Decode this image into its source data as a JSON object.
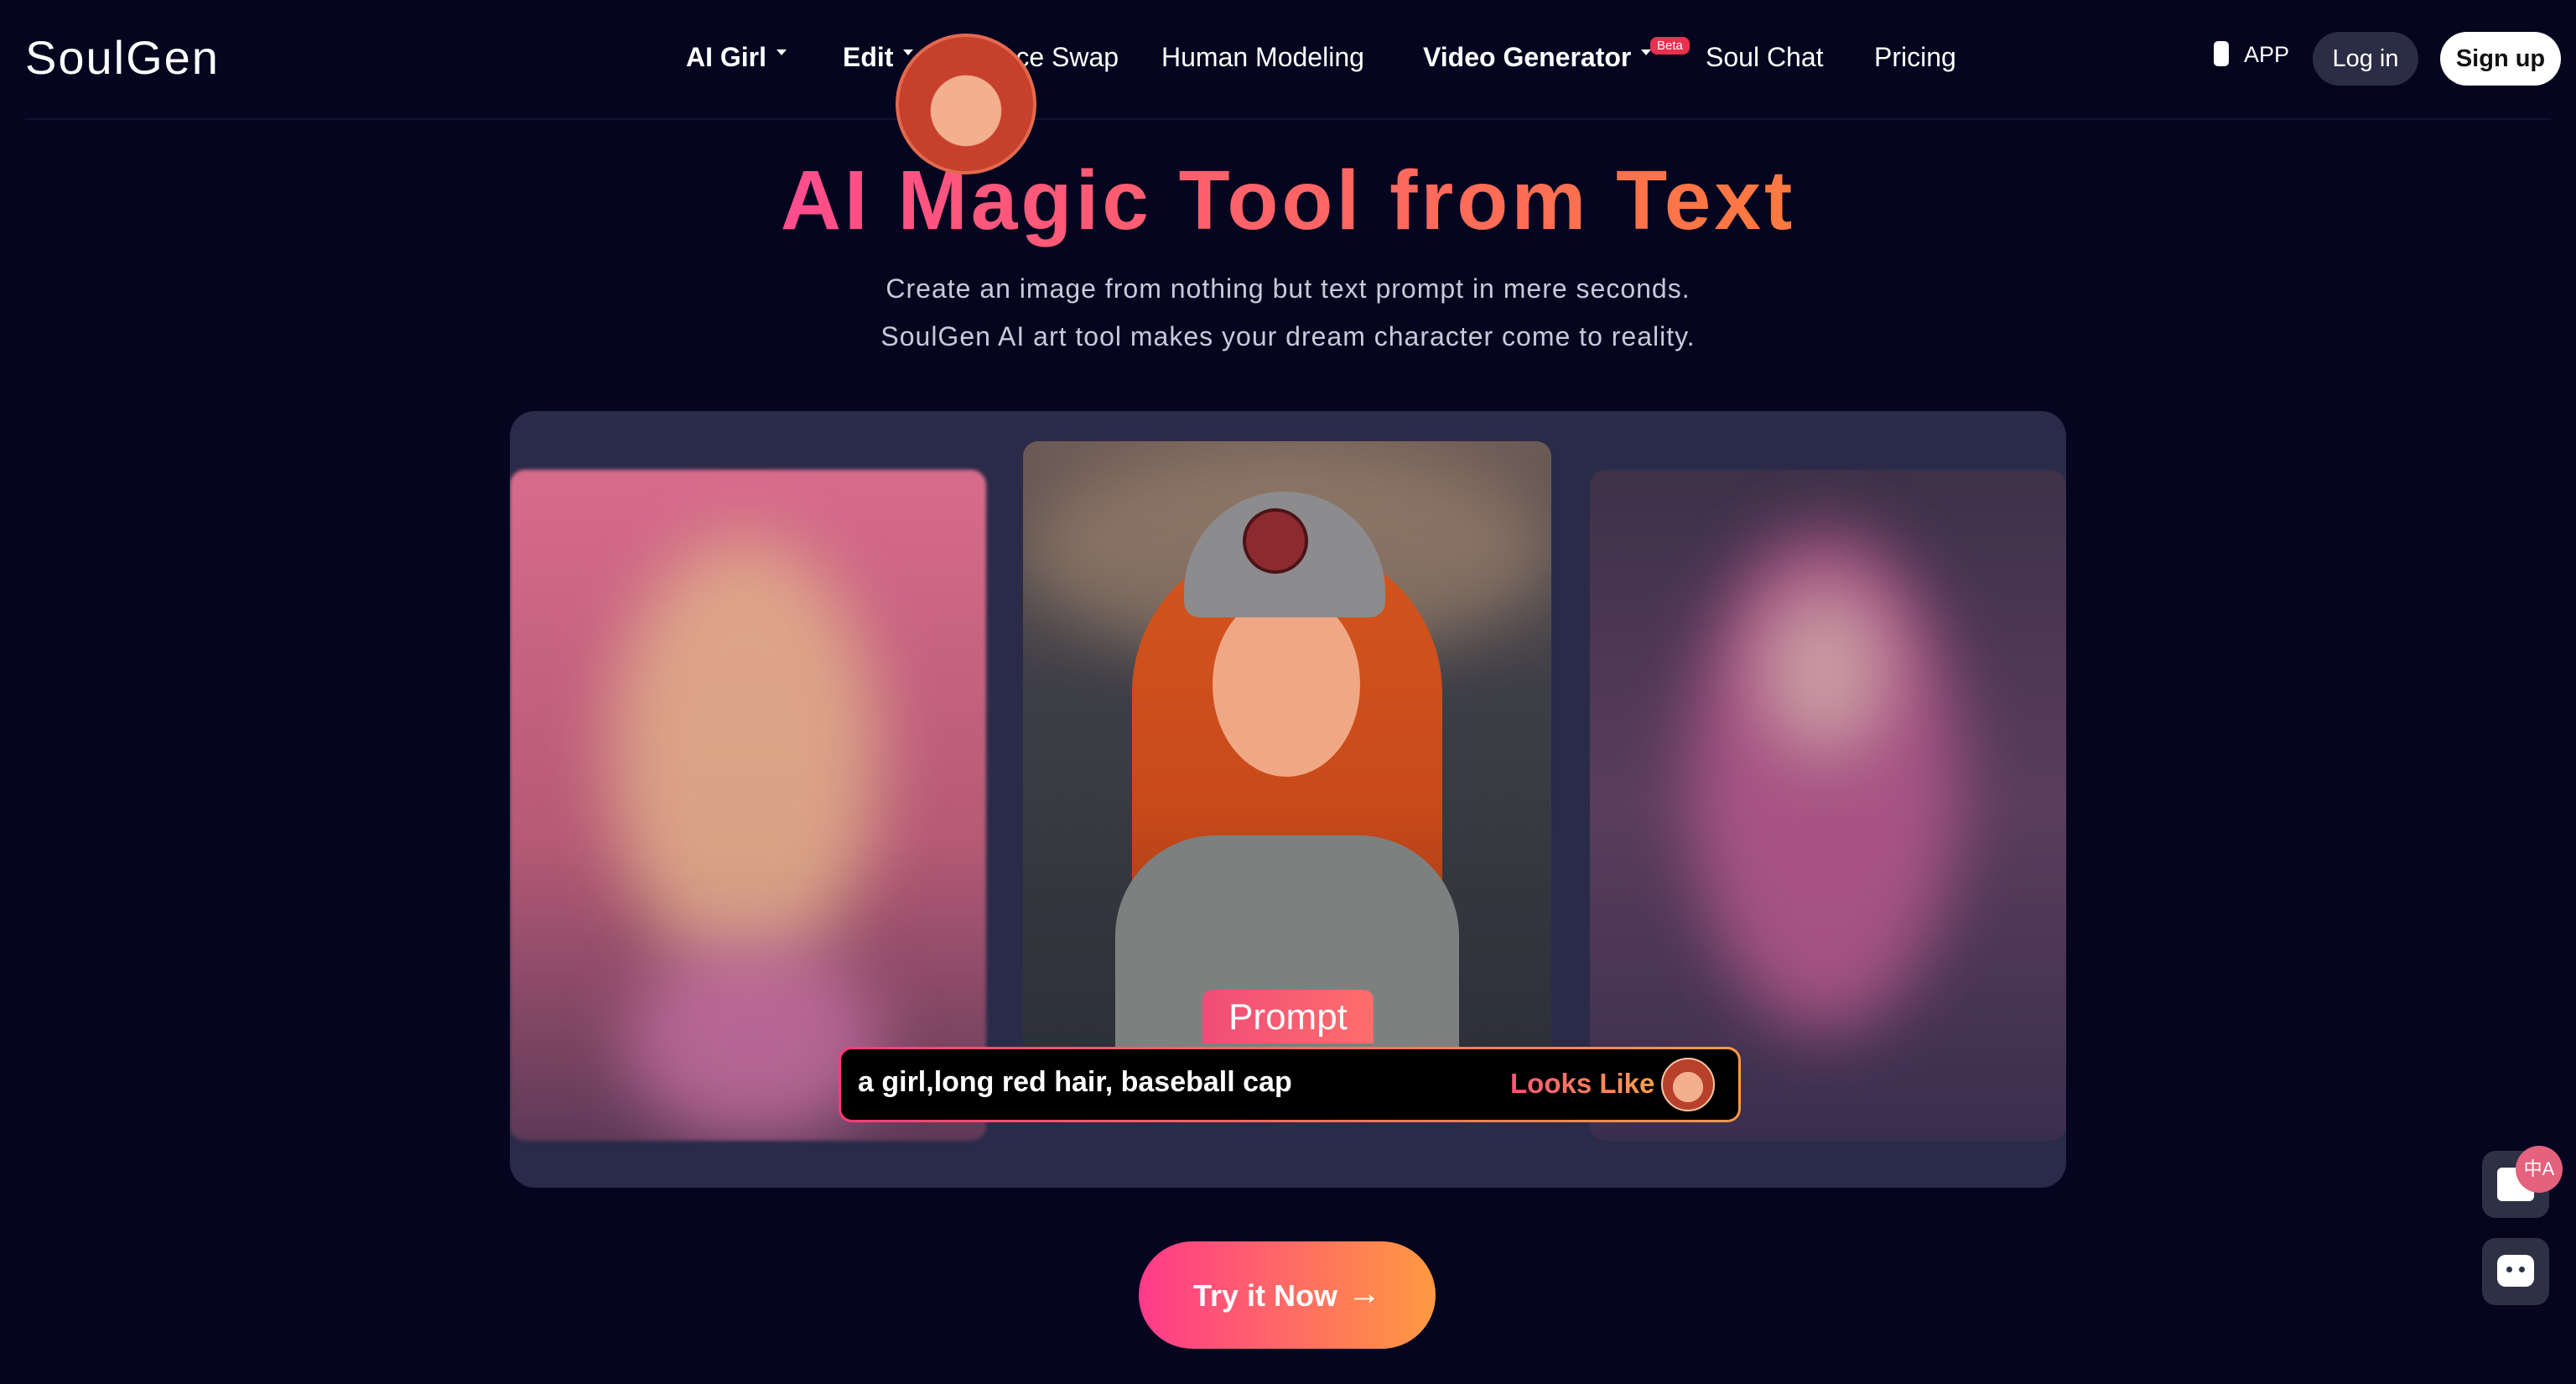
{
  "brand": {
    "logo_text": "SoulGen"
  },
  "nav": {
    "items": [
      {
        "label": "AI Girl",
        "has_caret": true
      },
      {
        "label": "Edit",
        "has_caret": true
      },
      {
        "label": "Face Swap",
        "has_caret": false
      },
      {
        "label": "Human Modeling",
        "has_caret": false
      },
      {
        "label": "Video Generator",
        "has_caret": true,
        "badge": "Beta"
      },
      {
        "label": "Soul Chat",
        "has_caret": false
      },
      {
        "label": "Pricing",
        "has_caret": false
      }
    ],
    "app_label": "APP",
    "login_label": "Log in",
    "signup_label": "Sign up"
  },
  "hero": {
    "title": "AI Magic Tool from Text",
    "subtitle_line1": "Create an image from nothing but text prompt in mere seconds.",
    "subtitle_line2": "SoulGen AI art tool makes your dream character come to reality."
  },
  "showcase": {
    "prompt_label": "Prompt",
    "prompt_text": "a girl,long red hair, baseball cap",
    "looks_like_label": "Looks Like"
  },
  "cta": {
    "label": "Try it Now"
  },
  "floating": {
    "translate_badge": "中A"
  },
  "colors": {
    "background": "#050520",
    "accent_start": "#ff3a7a",
    "accent_end": "#ff9a40",
    "panel": "#2a2b48"
  }
}
